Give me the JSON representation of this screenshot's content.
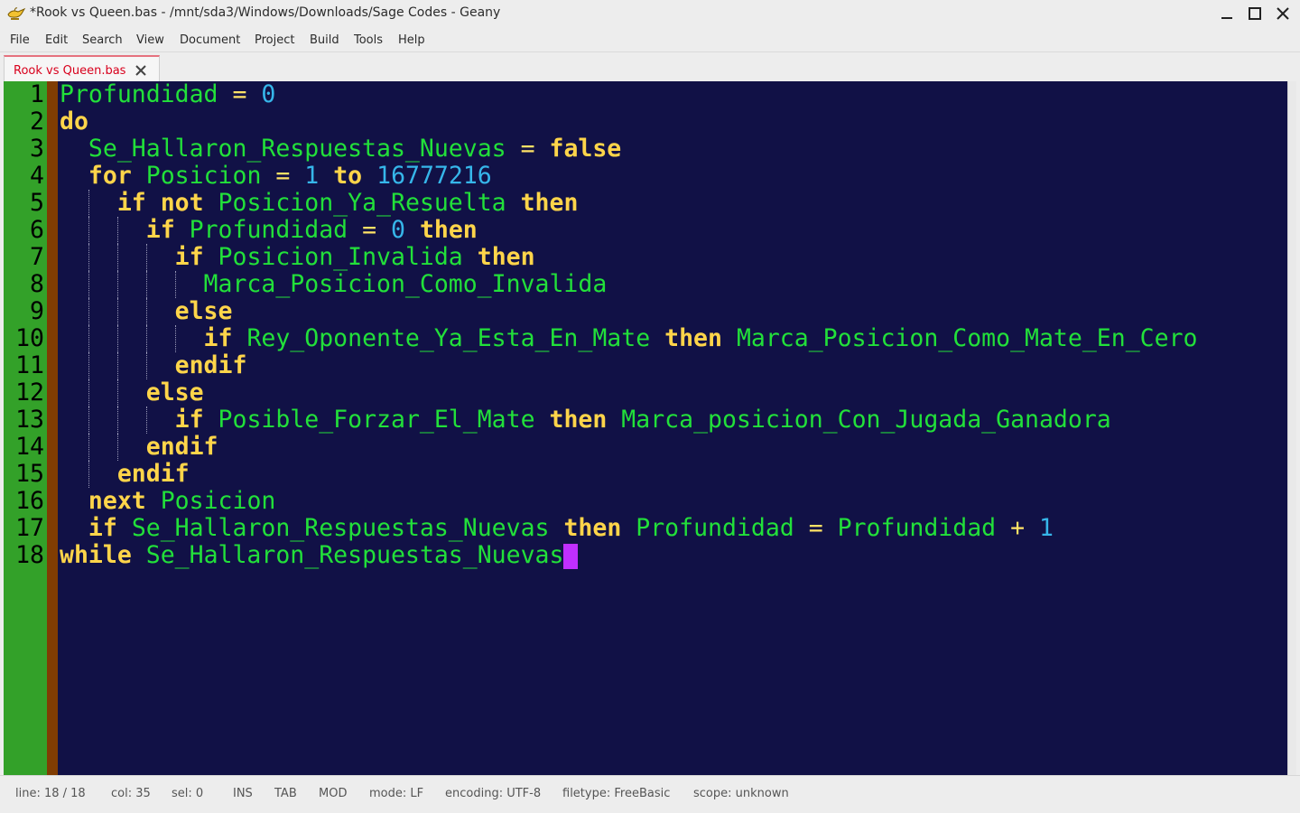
{
  "window": {
    "title": "*Rook vs Queen.bas - /mnt/sda3/Windows/Downloads/Sage Codes - Geany",
    "icon": "geany-lamp-icon"
  },
  "menu": {
    "items": [
      "File",
      "Edit",
      "Search",
      "View",
      "Document",
      "Project",
      "Build",
      "Tools",
      "Help"
    ]
  },
  "tabs": [
    {
      "label": "Rook vs Queen.bas",
      "active": true
    }
  ],
  "editor": {
    "line_numbers": [
      "1",
      "2",
      "3",
      "4",
      "5",
      "6",
      "7",
      "8",
      "9",
      "10",
      "11",
      "12",
      "13",
      "14",
      "15",
      "16",
      "17",
      "18"
    ],
    "colors": {
      "background": "#111146",
      "gutter": "#33a129",
      "fold_margin": "#803d03",
      "keyword": "#ffd54a",
      "identifier": "#22e03a",
      "number": "#36b6ea",
      "caret": "#c02fff"
    },
    "lines": [
      [
        [
          "id",
          "Profundidad"
        ],
        [
          "op",
          " = "
        ],
        [
          "num",
          "0"
        ]
      ],
      [
        [
          "kw",
          "do"
        ]
      ],
      [
        [
          "sp",
          "  "
        ],
        [
          "id",
          "Se_Hallaron_Respuestas_Nuevas"
        ],
        [
          "op",
          " = "
        ],
        [
          "kw",
          "false"
        ]
      ],
      [
        [
          "sp",
          "  "
        ],
        [
          "kw",
          "for"
        ],
        [
          "sp",
          " "
        ],
        [
          "id",
          "Posicion"
        ],
        [
          "op",
          " = "
        ],
        [
          "num",
          "1"
        ],
        [
          "sp",
          " "
        ],
        [
          "kw",
          "to"
        ],
        [
          "sp",
          " "
        ],
        [
          "num",
          "16777216"
        ]
      ],
      [
        [
          "sp",
          "    "
        ],
        [
          "kw",
          "if not"
        ],
        [
          "sp",
          " "
        ],
        [
          "id",
          "Posicion_Ya_Resuelta"
        ],
        [
          "sp",
          " "
        ],
        [
          "kw",
          "then"
        ]
      ],
      [
        [
          "sp",
          "      "
        ],
        [
          "kw",
          "if"
        ],
        [
          "sp",
          " "
        ],
        [
          "id",
          "Profundidad"
        ],
        [
          "op",
          " = "
        ],
        [
          "num",
          "0"
        ],
        [
          "sp",
          " "
        ],
        [
          "kw",
          "then"
        ]
      ],
      [
        [
          "sp",
          "        "
        ],
        [
          "kw",
          "if"
        ],
        [
          "sp",
          " "
        ],
        [
          "id",
          "Posicion_Invalida"
        ],
        [
          "sp",
          " "
        ],
        [
          "kw",
          "then"
        ]
      ],
      [
        [
          "sp",
          "          "
        ],
        [
          "id",
          "Marca_Posicion_Como_Invalida"
        ]
      ],
      [
        [
          "sp",
          "        "
        ],
        [
          "kw",
          "else"
        ]
      ],
      [
        [
          "sp",
          "          "
        ],
        [
          "kw",
          "if"
        ],
        [
          "sp",
          " "
        ],
        [
          "id",
          "Rey_Oponente_Ya_Esta_En_Mate"
        ],
        [
          "sp",
          " "
        ],
        [
          "kw",
          "then"
        ],
        [
          "sp",
          " "
        ],
        [
          "id",
          "Marca_Posicion_Como_Mate_En_Cero"
        ]
      ],
      [
        [
          "sp",
          "        "
        ],
        [
          "kw",
          "endif"
        ]
      ],
      [
        [
          "sp",
          "      "
        ],
        [
          "kw",
          "else"
        ]
      ],
      [
        [
          "sp",
          "        "
        ],
        [
          "kw",
          "if"
        ],
        [
          "sp",
          " "
        ],
        [
          "id",
          "Posible_Forzar_El_Mate"
        ],
        [
          "sp",
          " "
        ],
        [
          "kw",
          "then"
        ],
        [
          "sp",
          " "
        ],
        [
          "id",
          "Marca_posicion_Con_Jugada_Ganadora"
        ]
      ],
      [
        [
          "sp",
          "      "
        ],
        [
          "kw",
          "endif"
        ]
      ],
      [
        [
          "sp",
          "    "
        ],
        [
          "kw",
          "endif"
        ]
      ],
      [
        [
          "sp",
          "  "
        ],
        [
          "kw",
          "next"
        ],
        [
          "sp",
          " "
        ],
        [
          "id",
          "Posicion"
        ]
      ],
      [
        [
          "sp",
          "  "
        ],
        [
          "kw",
          "if"
        ],
        [
          "sp",
          " "
        ],
        [
          "id",
          "Se_Hallaron_Respuestas_Nuevas"
        ],
        [
          "sp",
          " "
        ],
        [
          "kw",
          "then"
        ],
        [
          "sp",
          " "
        ],
        [
          "id",
          "Profundidad"
        ],
        [
          "op",
          " = "
        ],
        [
          "id",
          "Profundidad"
        ],
        [
          "op",
          " + "
        ],
        [
          "num",
          "1"
        ]
      ],
      [
        [
          "kw",
          "while"
        ],
        [
          "sp",
          " "
        ],
        [
          "id",
          "Se_Hallaron_Respuestas_Nuevas"
        ]
      ]
    ]
  },
  "status": {
    "line": "line: 18 / 18",
    "col": "col: 35",
    "sel": "sel: 0",
    "ins": "INS",
    "tab": "TAB",
    "mod": "MOD",
    "mode": "mode: LF",
    "encoding": "encoding: UTF-8",
    "filetype": "filetype: FreeBasic",
    "scope": "scope: unknown"
  }
}
